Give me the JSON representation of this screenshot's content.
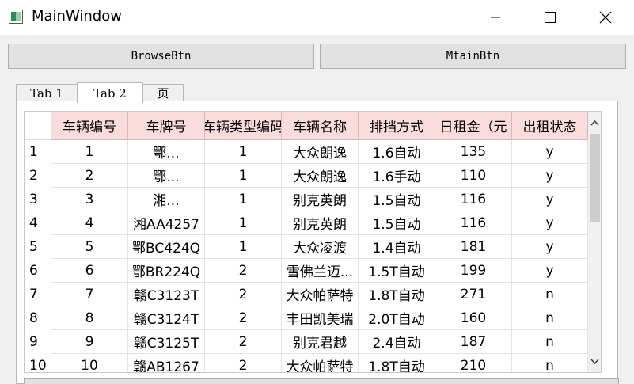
{
  "window": {
    "title": "MainWindow"
  },
  "toolbar": {
    "browse_label": "BrowseBtn",
    "mtain_label": "MtainBtn"
  },
  "tabs": [
    {
      "label": "Tab 1"
    },
    {
      "label": "Tab 2"
    },
    {
      "label": "页"
    }
  ],
  "active_tab": "Tab 2",
  "table": {
    "header_bg": "#fbdcdc",
    "columns": [
      "车辆编号",
      "车牌号",
      "车辆类型编码",
      "车辆名称",
      "排挡方式",
      "日租金（元",
      "出租状态"
    ],
    "rows": [
      {
        "num": "1",
        "cells": [
          "1",
          "鄂...",
          "1",
          "大众朗逸",
          "1.6自动",
          "135",
          "y"
        ]
      },
      {
        "num": "2",
        "cells": [
          "2",
          "鄂...",
          "1",
          "大众朗逸",
          "1.6手动",
          "110",
          "y"
        ]
      },
      {
        "num": "3",
        "cells": [
          "3",
          "湘...",
          "1",
          "别克英朗",
          "1.5自动",
          "116",
          "y"
        ]
      },
      {
        "num": "4",
        "cells": [
          "4",
          "湘AA4257",
          "1",
          "别克英朗",
          "1.5自动",
          "116",
          "y"
        ]
      },
      {
        "num": "5",
        "cells": [
          "5",
          "鄂BC424Q",
          "1",
          "大众凌渡",
          "1.4自动",
          "181",
          "y"
        ]
      },
      {
        "num": "6",
        "cells": [
          "6",
          "鄂BR224Q",
          "2",
          "雪佛兰迈...",
          "1.5T自动",
          "199",
          "y"
        ]
      },
      {
        "num": "7",
        "cells": [
          "7",
          "赣C3123T",
          "2",
          "大众帕萨特",
          "1.8T自动",
          "271",
          "n"
        ]
      },
      {
        "num": "8",
        "cells": [
          "8",
          "赣C3124T",
          "2",
          "丰田凯美瑞",
          "2.0T自动",
          "160",
          "n"
        ]
      },
      {
        "num": "9",
        "cells": [
          "9",
          "赣C3125T",
          "2",
          "别克君越",
          "2.4自动",
          "187",
          "n"
        ]
      },
      {
        "num": "10",
        "cells": [
          "10",
          "赣AB1267",
          "2",
          "大众帕萨特",
          "1.8T自动",
          "210",
          "n"
        ]
      }
    ]
  }
}
